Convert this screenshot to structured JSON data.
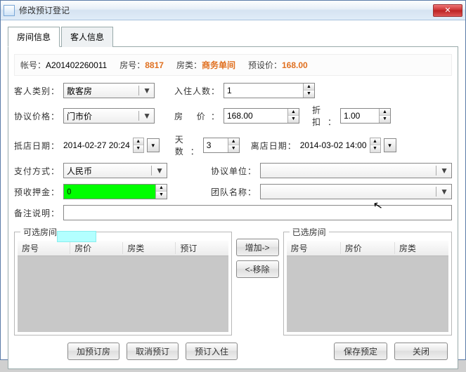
{
  "window": {
    "title": "修改预订登记"
  },
  "tabs": {
    "room": "房间信息",
    "guest": "客人信息"
  },
  "info": {
    "account_lbl": "帐号：",
    "account_val": "A201402260011",
    "roomno_lbl": "房号：",
    "roomno_val": "8817",
    "roomtype_lbl": "房类：",
    "roomtype_val": "商务单间",
    "preprice_lbl": "预设价：",
    "preprice_val": "168.00"
  },
  "form": {
    "guest_type_lbl": "客人类别",
    "guest_type_val": "散客房",
    "checkin_count_lbl": "入住人数",
    "checkin_count_val": "1",
    "agree_price_lbl": "协议价格",
    "agree_price_val": "门市价",
    "room_price_lbl": "房 价",
    "room_price_val": "168.00",
    "discount_lbl": "折扣",
    "discount_val": "1.00",
    "arrive_lbl": "抵店日期",
    "arrive_val": "2014-02-27 20:24",
    "days_lbl": "天数",
    "days_val": "3",
    "leave_lbl": "离店日期",
    "leave_val": "2014-03-02 14:00",
    "pay_method_lbl": "支付方式",
    "pay_method_val": "人民币",
    "agree_unit_lbl": "协议单位",
    "deposit_lbl": "预收押金",
    "deposit_val": "0",
    "team_lbl": "团队名称",
    "remark_lbl": "备注说明"
  },
  "lists": {
    "avail_title": "可选房间",
    "sel_title": "已选房间",
    "cols_avail": {
      "c1": "房号",
      "c2": "房价",
      "c3": "房类",
      "c4": "预订"
    },
    "cols_sel": {
      "c1": "房号",
      "c2": "房价",
      "c3": "房类"
    }
  },
  "buttons": {
    "add": "增加->",
    "remove": "<-移除",
    "add_reserve": "加预订房",
    "cancel_reserve": "取消预订",
    "reserve_checkin": "预订入住",
    "save": "保存预定",
    "close": "关闭"
  }
}
